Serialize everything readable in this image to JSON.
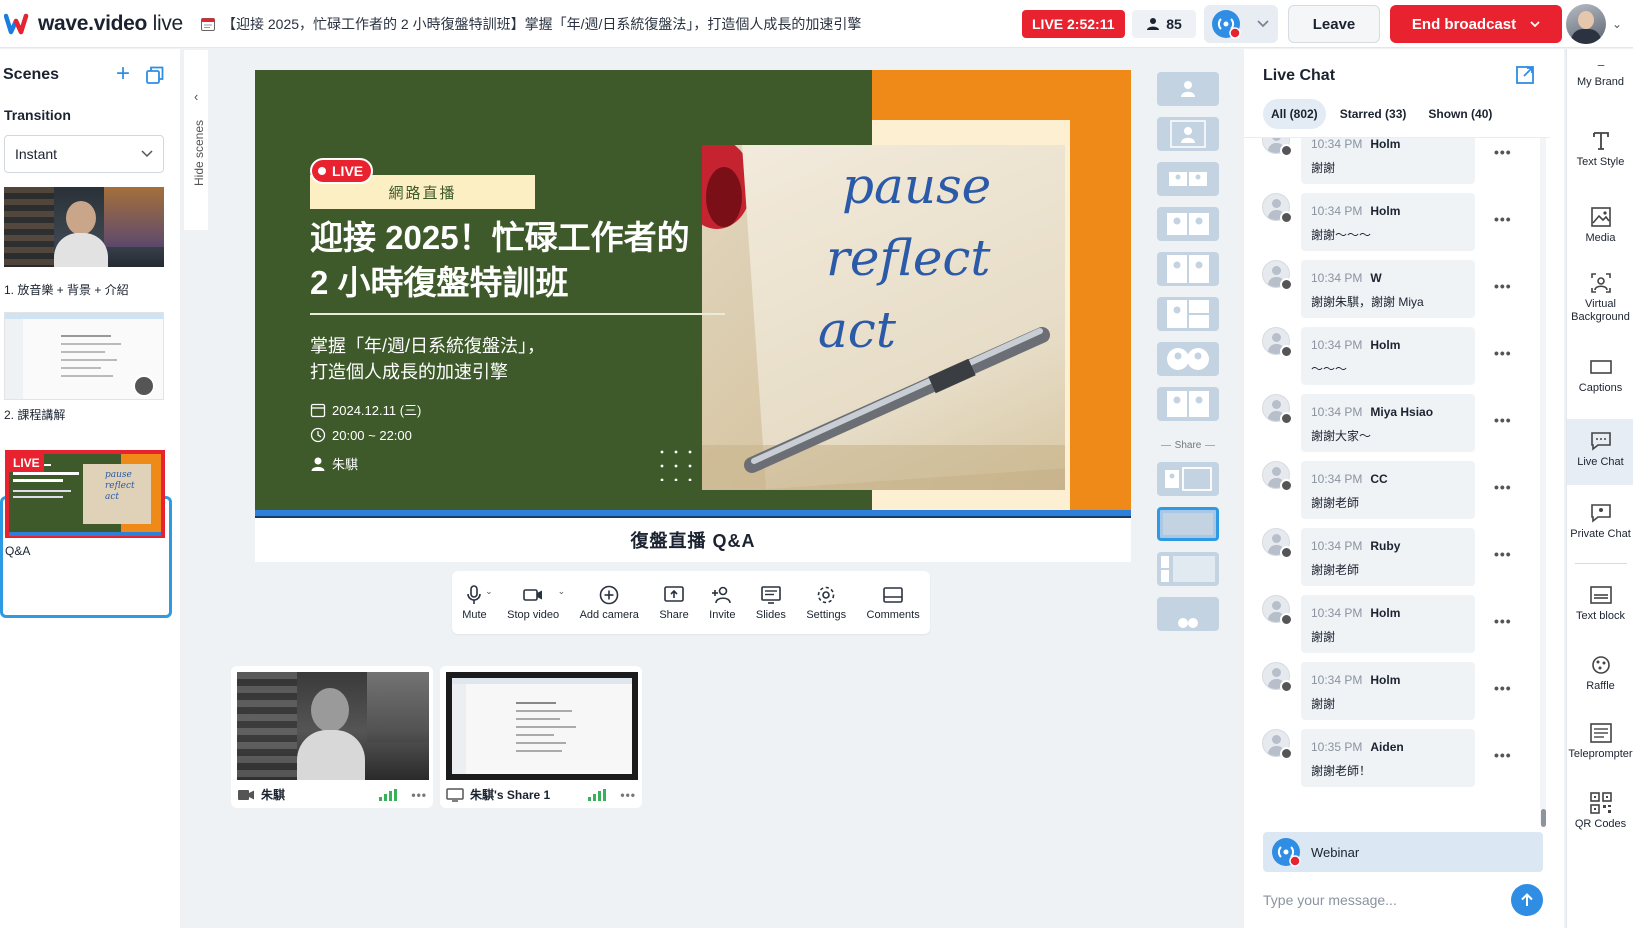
{
  "app": {
    "logo_bold": "wave.video",
    "logo_light": " live",
    "title": "【迎接 2025，忙碌工作者的 2 小時復盤特訓班】掌握「年/週/日系統復盤法」，打造個人成長的加速引擎"
  },
  "header": {
    "live_timer": "LIVE 2:52:11",
    "viewer_count": "85",
    "leave_label": "Leave",
    "end_label": "End broadcast"
  },
  "scenes": {
    "title": "Scenes",
    "transition_label": "Transition",
    "transition_value": "Instant",
    "items": [
      {
        "label": "1. 放音樂 + 背景 + 介紹"
      },
      {
        "label": "2. 課程講解"
      },
      {
        "label": "Q&A"
      }
    ],
    "hide_label": "Hide scenes",
    "thumb_live": "LIVE"
  },
  "stage": {
    "live_badge": "LIVE",
    "tag": "網路直播",
    "title_line1": "迎接 2025！忙碌工作者的",
    "title_line2": "2 小時復盤特訓班",
    "subtitle_line1": "掌握「年/週/日系統復盤法」，",
    "subtitle_line2": "打造個人成長的加速引擎",
    "date": "2024.12.11 (三)",
    "time": "20:00 ~ 22:00",
    "host": "朱騏",
    "photo_text": [
      "pause",
      "reflect",
      "act"
    ],
    "caption": "復盤直播  Q&A"
  },
  "controls": [
    {
      "label": "Mute",
      "icon": "microphone-icon"
    },
    {
      "label": "Stop video",
      "icon": "camera-icon"
    },
    {
      "label": "Add camera",
      "icon": "add-circle-icon"
    },
    {
      "label": "Share",
      "icon": "share-screen-icon"
    },
    {
      "label": "Invite",
      "icon": "invite-person-icon"
    },
    {
      "label": "Slides",
      "icon": "slides-icon"
    },
    {
      "label": "Settings",
      "icon": "gear-icon"
    },
    {
      "label": "Comments",
      "icon": "comments-icon"
    }
  ],
  "layouts": {
    "share_label": "Share"
  },
  "participants": [
    {
      "name": "朱騏",
      "icon": "camera-icon"
    },
    {
      "name": "朱騏's Share 1",
      "icon": "monitor-icon"
    }
  ],
  "chat": {
    "title": "Live Chat",
    "tabs": [
      {
        "label": "All (802)"
      },
      {
        "label": "Starred (33)"
      },
      {
        "label": "Shown (40)"
      }
    ],
    "messages": [
      {
        "time": "10:34 PM",
        "name": "Holm",
        "text": "謝謝"
      },
      {
        "time": "10:34 PM",
        "name": "Holm",
        "text": "謝謝～～～"
      },
      {
        "time": "10:34 PM",
        "name": "W",
        "text": "謝謝朱騏，謝謝 Miya"
      },
      {
        "time": "10:34 PM",
        "name": "Holm",
        "text": "～～～"
      },
      {
        "time": "10:34 PM",
        "name": "Miya Hsiao",
        "text": "謝謝大家～"
      },
      {
        "time": "10:34 PM",
        "name": "CC",
        "text": "謝謝老師"
      },
      {
        "time": "10:34 PM",
        "name": "Ruby",
        "text": "謝謝老師"
      },
      {
        "time": "10:34 PM",
        "name": "Holm",
        "text": "謝謝"
      },
      {
        "time": "10:34 PM",
        "name": "Holm",
        "text": "謝謝"
      },
      {
        "time": "10:35 PM",
        "name": "Aiden",
        "text": "謝謝老師！"
      }
    ],
    "webinar_label": "Webinar",
    "input_placeholder": "Type your message..."
  },
  "rail": [
    {
      "label": "My Brand",
      "icon": "brand-icon"
    },
    {
      "label": "Text Style",
      "icon": "text-style-icon"
    },
    {
      "label": "Media",
      "icon": "media-icon"
    },
    {
      "label": "Virtual Background",
      "icon": "virtual-background-icon"
    },
    {
      "label": "Captions",
      "icon": "captions-icon"
    },
    {
      "label": "Live Chat",
      "icon": "live-chat-icon"
    },
    {
      "label": "Private Chat",
      "icon": "private-chat-icon"
    },
    {
      "label": "Text block",
      "icon": "text-block-icon"
    },
    {
      "label": "Raffle",
      "icon": "raffle-icon"
    },
    {
      "label": "Teleprompter",
      "icon": "teleprompter-icon"
    },
    {
      "label": "QR Codes",
      "icon": "qr-code-icon"
    }
  ],
  "colors": {
    "accent_blue": "#2f8de4",
    "live_red": "#e8232f",
    "slide_green": "#3e5a2a",
    "slide_orange": "#ef8a18"
  }
}
